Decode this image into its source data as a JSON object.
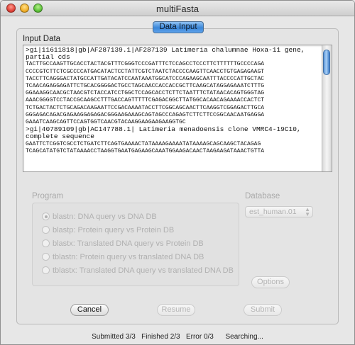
{
  "window": {
    "title": "multiFasta"
  },
  "tabs": [
    {
      "label": "Data Input"
    }
  ],
  "input": {
    "label": "Input Data",
    "lines": [
      ">gi|11611818|gb|AF287139.1|AF287139 Latimeria chalumnae Hoxa-11 gene,",
      "partial cds",
      "TACTTGCCAAGTTGCACCTACTACGTTTCGGGTCCCGATTTCTCCAGCCTCCCTTCTTTTTTGCCCCAGA",
      "CCCCGTCTTCTCGCCCCATGACATACTCCTATTCGTCTAATCTACCCCAAGTTCAACCTGTGAGAGAAGT",
      "TACCTTCAGGGACTATGCCATTGATACATCCAATAAATGGCATCCCAGAAGCAATTTACCCCATTGCTAC",
      "TCAACAGAGGAGATTCTGCACGGGGACTGCCTAGCAACCACCACCGCTTCAAGCATAGGAGAAATCTTTG",
      "GGAAAGGCAACGCTAACGTCTACCATCCTGGCTCCAGCACCTCTTCTAATTTCTATAACACAGTGGGTAG",
      "AAACGGGGTCCTACCGCAAGCCTTTGACCAGTTTTTCGAGACGGCTTATGGCACAACAGAAAACCACTCT",
      "TCTGACTACTCTGCAGACAAGAATTCCGACAAAATACCTTCGGCAGCAACTTCAAGGTCGGAGACTTGCA",
      "GGGAGACAGACGAGAAGGAGAGACGGGAAGAAAGCAGTAGCCCAGAGTCTTCTTCCGGCAACAATGAGGA",
      "GAAATCAAGCAGTTCCAGTGGTCAACGTACAAGGAAGAAGAAGGTGC",
      ">gi|40789109|gb|AC147788.1| Latimeria menadoensis clone VMRC4-19C10,",
      "complete sequence",
      "GAATTCTCGGTCGCCTCTGATCTTCAGTGAAAACTATAAAAGAAAATATAAAAGCAGCAAGCTACAGAG",
      "TCAGCATATGTCTATAAAACCTAAGGTGAATGAGAAGCAAATGGAAGACAACTAAGAAGATAAACTGTTA"
    ]
  },
  "program": {
    "label": "Program",
    "options": [
      "blastn: DNA query vs DNA DB",
      "blastp: Protein query vs Protein DB",
      "blastx: Translated DNA query vs Protein DB",
      "tblastn: Protein query vs translated DNA DB",
      "tblastx: Translated DNA query vs translated DNA DB"
    ],
    "selected_index": 0
  },
  "database": {
    "label": "Database",
    "value": "est_human.01"
  },
  "buttons": {
    "options": "Options",
    "cancel": "Cancel",
    "resume": "Resume",
    "submit": "Submit"
  },
  "status": "Submitted 3/3   Finished 2/3   Error 0/3      Searching..."
}
